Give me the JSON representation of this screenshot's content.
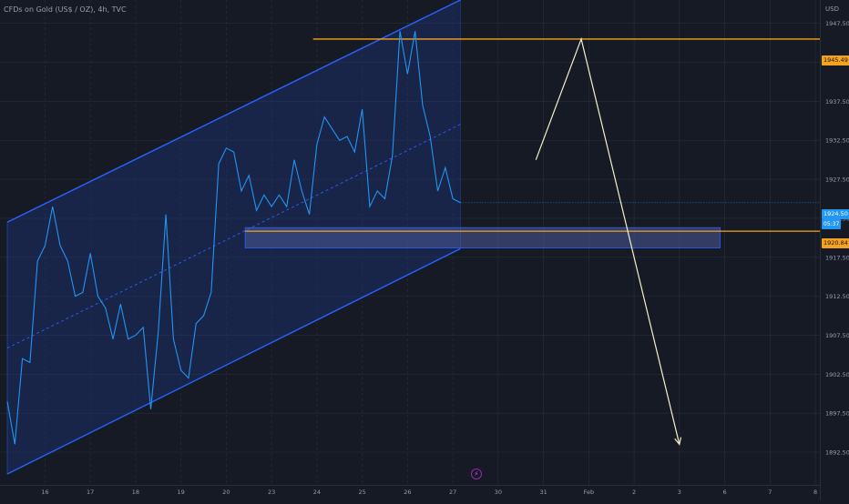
{
  "title": "CFDs on Gold (US$ / OZ), 4h, TVC",
  "currency": "USD",
  "colors": {
    "background": "#161a25",
    "channel_line": "#2962ff",
    "channel_fill": "#1e3a8a",
    "price_line": "#2196f3",
    "level_line": "#f7a21b",
    "projection": "#f4f0c8",
    "grid": "#2a2e39"
  },
  "price_tags": {
    "last_price": "1924.50",
    "countdown": "05:37",
    "upper_level": "1945.49",
    "lower_level": "1920.84"
  },
  "icons": {
    "bolt": "lightning-bolt-icon"
  },
  "chart_data": {
    "type": "line",
    "title": "CFDs on Gold (US$ / OZ), 4h, TVC",
    "y_axis": {
      "ticks": [
        1947.5,
        1942.5,
        1937.5,
        1932.5,
        1927.5,
        1922.5,
        1917.5,
        1912.5,
        1907.5,
        1902.5,
        1897.5,
        1892.5
      ],
      "ylim": [
        1889.7,
        1950.5
      ]
    },
    "x_axis": {
      "ticks": [
        {
          "label": "16",
          "i": 5
        },
        {
          "label": "17",
          "i": 11
        },
        {
          "label": "18",
          "i": 17
        },
        {
          "label": "19",
          "i": 23
        },
        {
          "label": "20",
          "i": 29
        },
        {
          "label": "23",
          "i": 35
        },
        {
          "label": "24",
          "i": 41
        },
        {
          "label": "25",
          "i": 47
        },
        {
          "label": "26",
          "i": 53
        },
        {
          "label": "27",
          "i": 59
        },
        {
          "label": "30",
          "i": 65
        },
        {
          "label": "31",
          "i": 71
        },
        {
          "label": "Feb",
          "i": 77
        },
        {
          "label": "2",
          "i": 83
        },
        {
          "label": "3",
          "i": 89
        },
        {
          "label": "6",
          "i": 95
        },
        {
          "label": "7",
          "i": 101
        },
        {
          "label": "8",
          "i": 107
        }
      ],
      "xlim": [
        0,
        107.6
      ]
    },
    "grid": true,
    "series": [
      {
        "type": "line",
        "values": [
          [
            0,
            1899.0
          ],
          [
            1,
            1893.5
          ],
          [
            2,
            1904.5
          ],
          [
            3,
            1904.0
          ],
          [
            4,
            1917.0
          ],
          [
            5,
            1919.0
          ],
          [
            6,
            1924.0
          ],
          [
            7,
            1919.0
          ],
          [
            8,
            1917.0
          ],
          [
            9,
            1912.5
          ],
          [
            10,
            1913.0
          ],
          [
            11,
            1918.0
          ],
          [
            12,
            1912.5
          ],
          [
            13,
            1911.0
          ],
          [
            14,
            1907.0
          ],
          [
            15,
            1911.5
          ],
          [
            16,
            1907.0
          ],
          [
            17,
            1907.5
          ],
          [
            18,
            1908.5
          ],
          [
            19,
            1898.0
          ],
          [
            20,
            1908.0
          ],
          [
            21,
            1923.0
          ],
          [
            22,
            1907.0
          ],
          [
            23,
            1903.0
          ],
          [
            24,
            1902.0
          ],
          [
            25,
            1909.0
          ],
          [
            26,
            1910.0
          ],
          [
            27,
            1913.0
          ],
          [
            28,
            1929.5
          ],
          [
            29,
            1931.5
          ],
          [
            30,
            1931.0
          ],
          [
            31,
            1926.0
          ],
          [
            32,
            1928.0
          ],
          [
            33,
            1923.5
          ],
          [
            34,
            1925.5
          ],
          [
            35,
            1924.0
          ],
          [
            36,
            1925.5
          ],
          [
            37,
            1924.0
          ],
          [
            38,
            1930.0
          ],
          [
            39,
            1926.0
          ],
          [
            40,
            1923.0
          ],
          [
            41,
            1932.0
          ],
          [
            42,
            1935.5
          ],
          [
            43,
            1934.0
          ],
          [
            44,
            1932.5
          ],
          [
            45,
            1933.0
          ],
          [
            46,
            1931.0
          ],
          [
            47,
            1936.5
          ],
          [
            48,
            1924.0
          ],
          [
            49,
            1926.0
          ],
          [
            50,
            1925.0
          ],
          [
            51,
            1930.5
          ],
          [
            52,
            1946.5
          ],
          [
            53,
            1941.0
          ],
          [
            54,
            1946.5
          ],
          [
            55,
            1937.0
          ],
          [
            56,
            1933.0
          ],
          [
            57,
            1926.0
          ],
          [
            58,
            1929.0
          ],
          [
            59,
            1925.0
          ],
          [
            60,
            1924.5
          ]
        ]
      }
    ],
    "channel": {
      "upper": [
        [
          0,
          1922.0
        ],
        [
          60,
          1950.5
        ]
      ],
      "lower": [
        [
          0,
          1889.7
        ],
        [
          60,
          1918.6
        ]
      ]
    },
    "levels": [
      {
        "value": 1945.49,
        "from": 40.5,
        "to": 107.6
      },
      {
        "value": 1920.84,
        "from": 31.5,
        "to": 107.6
      }
    ],
    "zone": {
      "from": 31.5,
      "to": 94.4,
      "top": 1921.3,
      "bottom": 1918.7
    },
    "projection": [
      [
        70,
        1930.0
      ],
      [
        76,
        1945.5
      ],
      [
        89,
        1893.5
      ]
    ]
  }
}
